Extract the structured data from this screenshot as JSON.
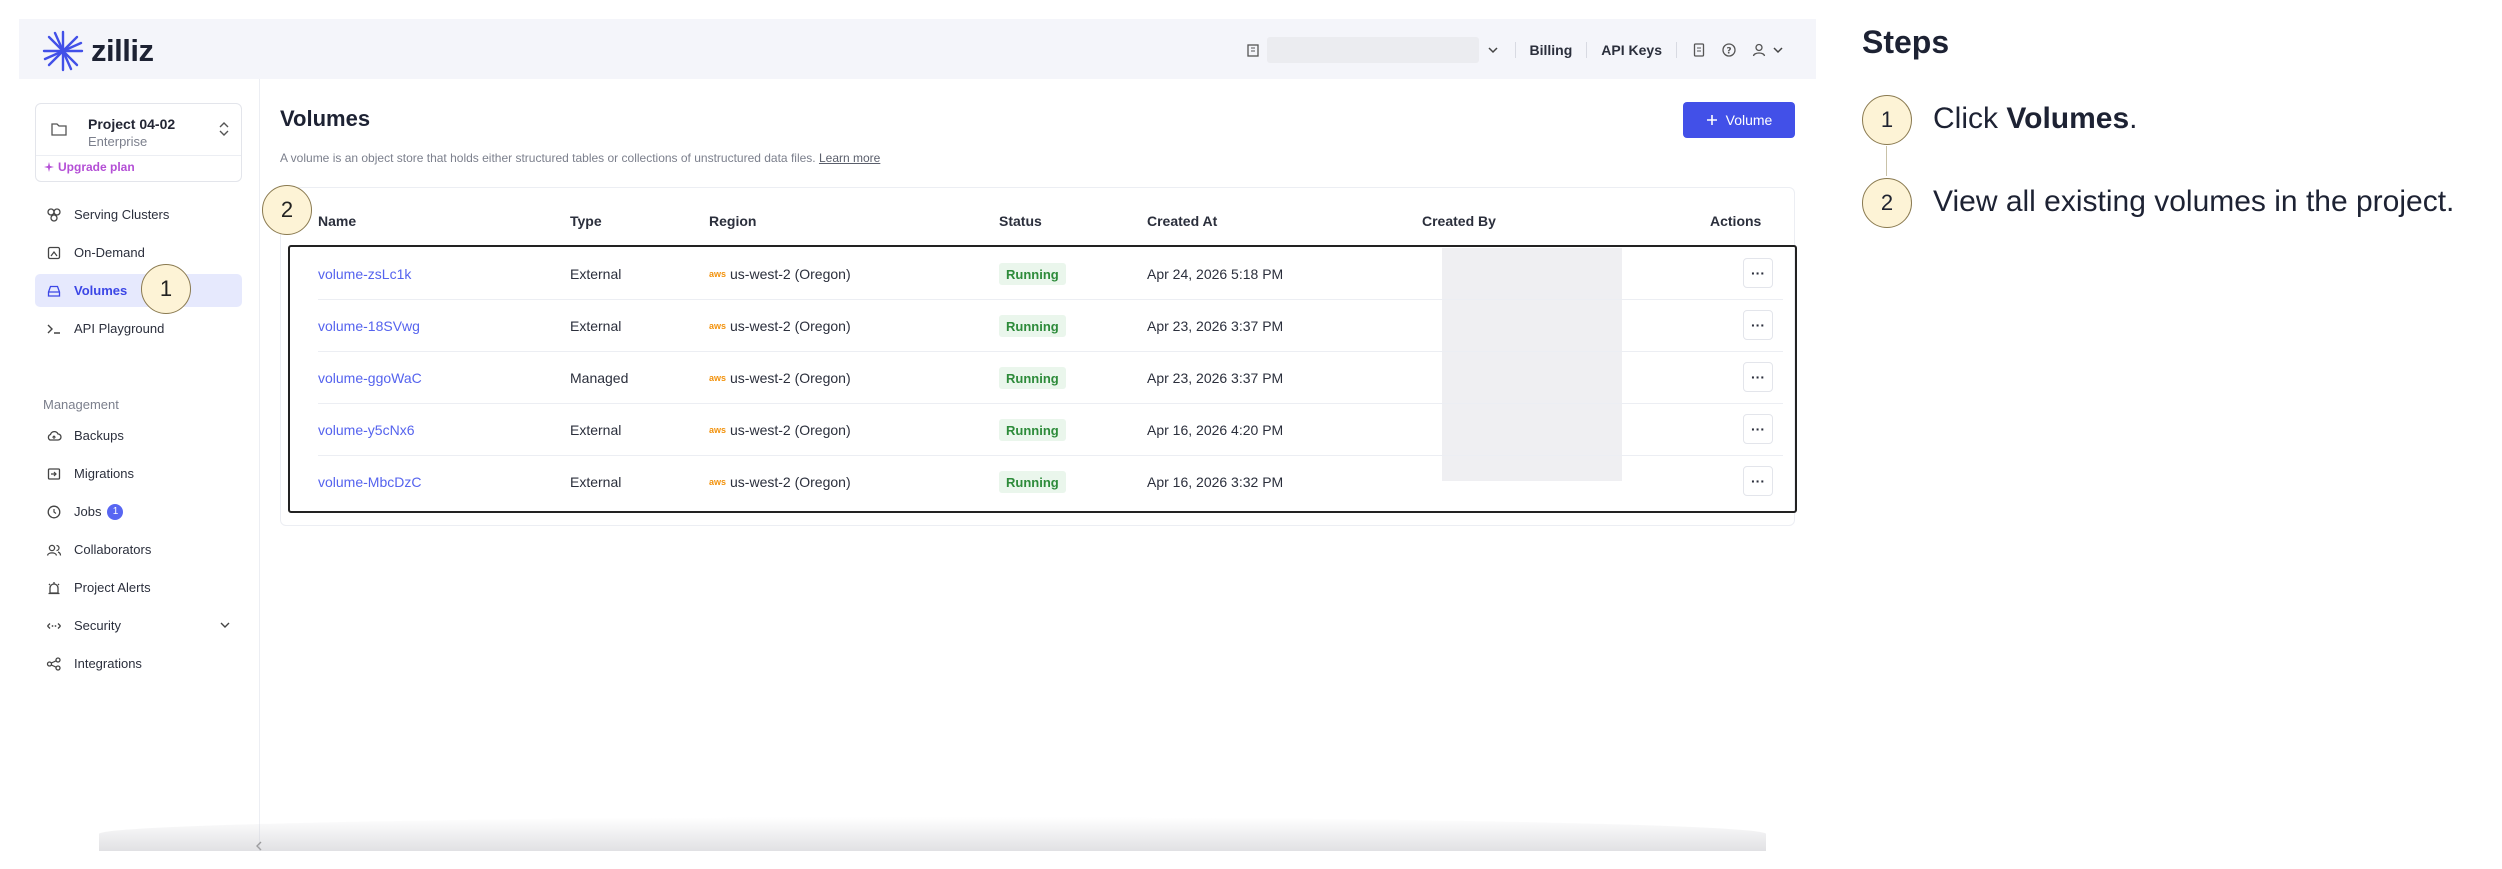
{
  "brand": {
    "name": "zilliz"
  },
  "topbar": {
    "links": [
      "Billing",
      "API Keys"
    ]
  },
  "sidebar": {
    "project": {
      "name": "Project 04-02",
      "tier": "Enterprise",
      "upgrade": "Upgrade plan"
    },
    "items": [
      {
        "label": "Serving Clusters",
        "icon": "cluster-icon"
      },
      {
        "label": "On-Demand",
        "icon": "on-demand-icon"
      },
      {
        "label": "Volumes",
        "icon": "volume-icon",
        "active": true
      },
      {
        "label": "API Playground",
        "icon": "terminal-icon"
      }
    ],
    "management_heading": "Management",
    "management_items": [
      {
        "label": "Backups",
        "icon": "cloud-backup-icon"
      },
      {
        "label": "Migrations",
        "icon": "migration-icon"
      },
      {
        "label": "Jobs",
        "icon": "clock-icon",
        "badge": "1"
      },
      {
        "label": "Collaborators",
        "icon": "users-icon"
      },
      {
        "label": "Project Alerts",
        "icon": "alarm-icon"
      },
      {
        "label": "Security",
        "icon": "security-icon"
      },
      {
        "label": "Integrations",
        "icon": "integrations-icon"
      }
    ]
  },
  "main": {
    "title": "Volumes",
    "description": "A volume is an object store that holds either structured tables or collections of unstructured data files.",
    "learn_more": "Learn more",
    "add_button": "Volume",
    "columns": [
      "Name",
      "Type",
      "Region",
      "Status",
      "Created At",
      "Created By",
      "Actions"
    ],
    "rows": [
      {
        "name": "volume-zsLc1k",
        "type": "External",
        "region": "us-west-2 (Oregon)",
        "status": "Running",
        "created_at": "Apr 24, 2026 5:18 PM"
      },
      {
        "name": "volume-18SVwg",
        "type": "External",
        "region": "us-west-2 (Oregon)",
        "status": "Running",
        "created_at": "Apr 23, 2026 3:37 PM"
      },
      {
        "name": "volume-ggoWaC",
        "type": "Managed",
        "region": "us-west-2 (Oregon)",
        "status": "Running",
        "created_at": "Apr 23, 2026 3:37 PM"
      },
      {
        "name": "volume-y5cNx6",
        "type": "External",
        "region": "us-west-2 (Oregon)",
        "status": "Running",
        "created_at": "Apr 16, 2026 4:20 PM"
      },
      {
        "name": "volume-MbcDzC",
        "type": "External",
        "region": "us-west-2 (Oregon)",
        "status": "Running",
        "created_at": "Apr 16, 2026 3:32 PM"
      }
    ],
    "aws_label": "aws",
    "more_label": "···"
  },
  "markers": [
    "1",
    "2"
  ],
  "steps": {
    "heading": "Steps",
    "items": [
      {
        "num": "1",
        "prefix": "Click ",
        "bold": "Volumes",
        "suffix": "."
      },
      {
        "num": "2",
        "prefix": "View all existing volumes in the project.",
        "bold": "",
        "suffix": ""
      }
    ]
  },
  "colors": {
    "accent": "#4250e8",
    "link": "#5563ee",
    "status_running_bg": "#eaf6ec",
    "status_running_text": "#2d8b3a",
    "marker_bg": "#fdf3d6"
  }
}
